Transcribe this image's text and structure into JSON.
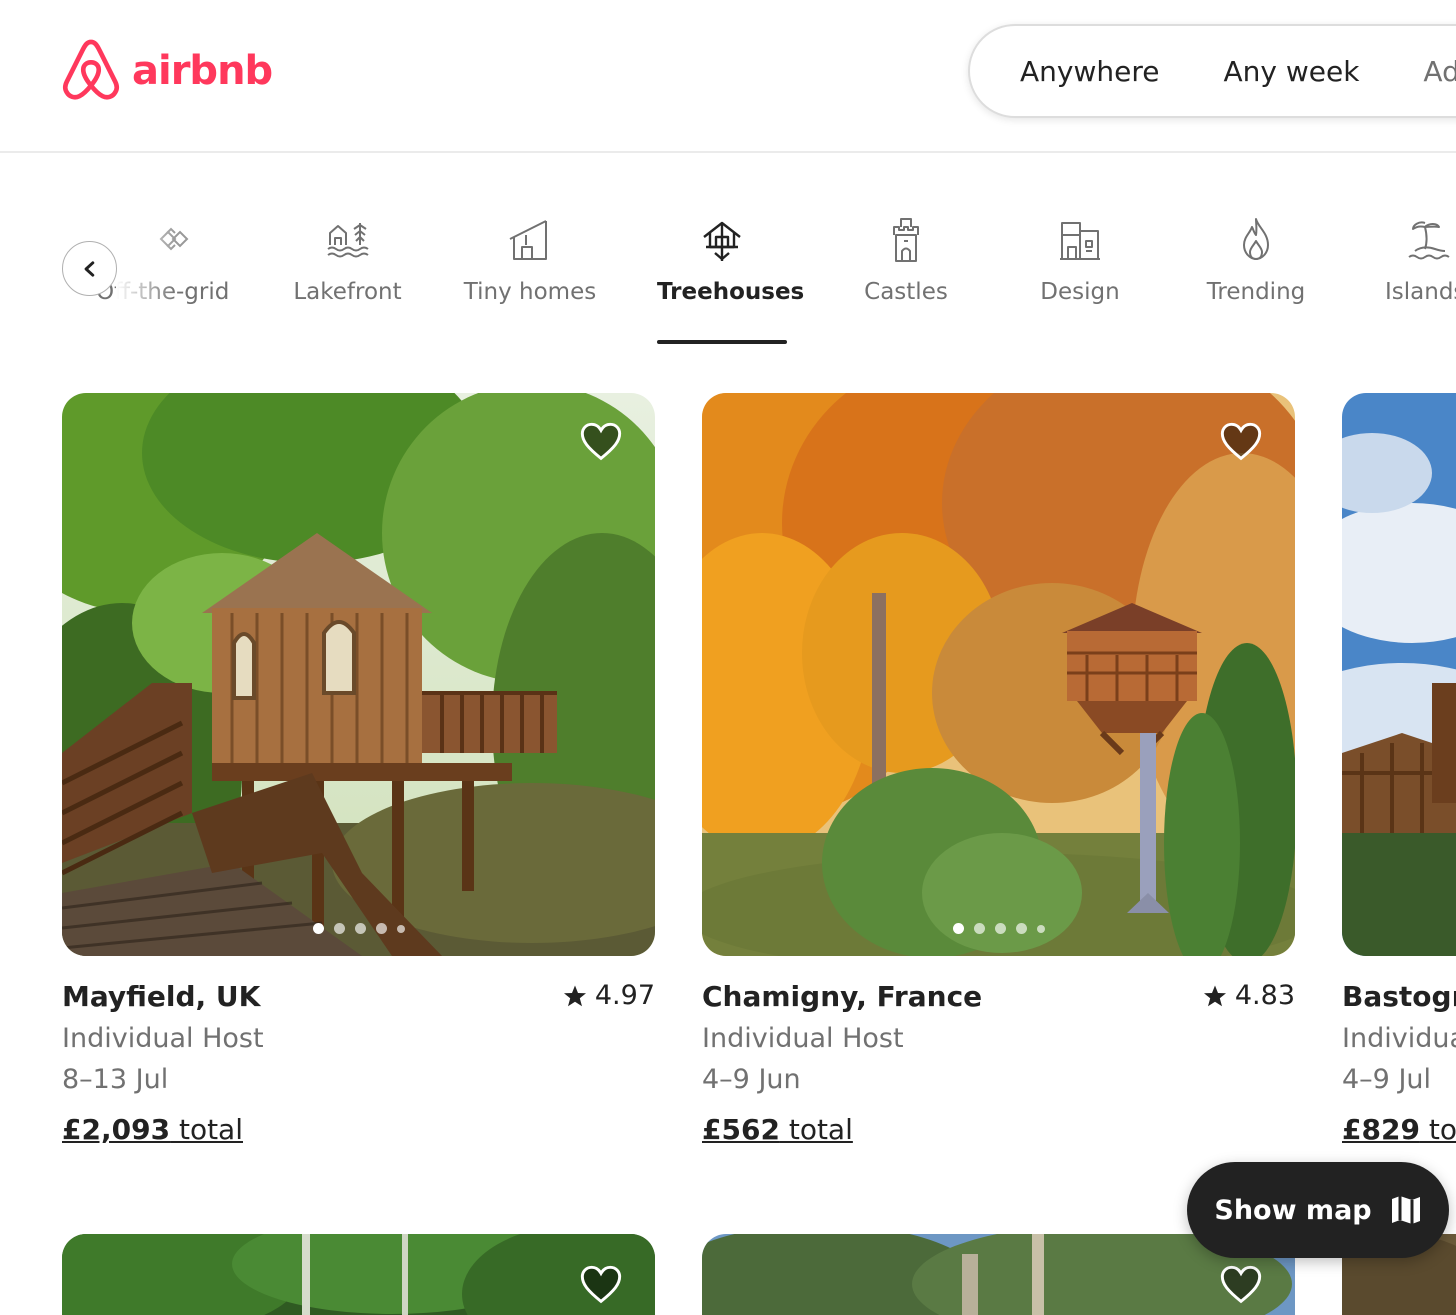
{
  "brand": {
    "name": "airbnb",
    "color": "#ff385c"
  },
  "search": {
    "location": "Anywhere",
    "week": "Any week",
    "guests": "Add guests"
  },
  "categories": [
    {
      "label": "Off-the-grid",
      "icon": "off-grid-icon"
    },
    {
      "label": "Lakefront",
      "icon": "lakefront-icon"
    },
    {
      "label": "Tiny homes",
      "icon": "tiny-home-icon"
    },
    {
      "label": "Treehouses",
      "icon": "treehouse-icon",
      "active": true
    },
    {
      "label": "Castles",
      "icon": "castle-icon"
    },
    {
      "label": "Design",
      "icon": "design-icon"
    },
    {
      "label": "Trending",
      "icon": "flame-icon"
    },
    {
      "label": "Islands",
      "icon": "island-icon"
    }
  ],
  "listings": [
    {
      "place": "Mayfield, UK",
      "rating": "4.97",
      "host": "Individual Host",
      "dates": "8–13 Jul",
      "price": "£2,093",
      "price_suffix": " total"
    },
    {
      "place": "Chamigny, France",
      "rating": "4.83",
      "host": "Individual Host",
      "dates": "4–9 Jun",
      "price": "£562",
      "price_suffix": " total"
    },
    {
      "place": "Bastogne",
      "host": "Individual",
      "dates": "4–9 Jul",
      "price": "£829",
      "price_suffix": " tot"
    }
  ],
  "show_map": {
    "label": "Show map",
    "icon": "map-icon"
  }
}
